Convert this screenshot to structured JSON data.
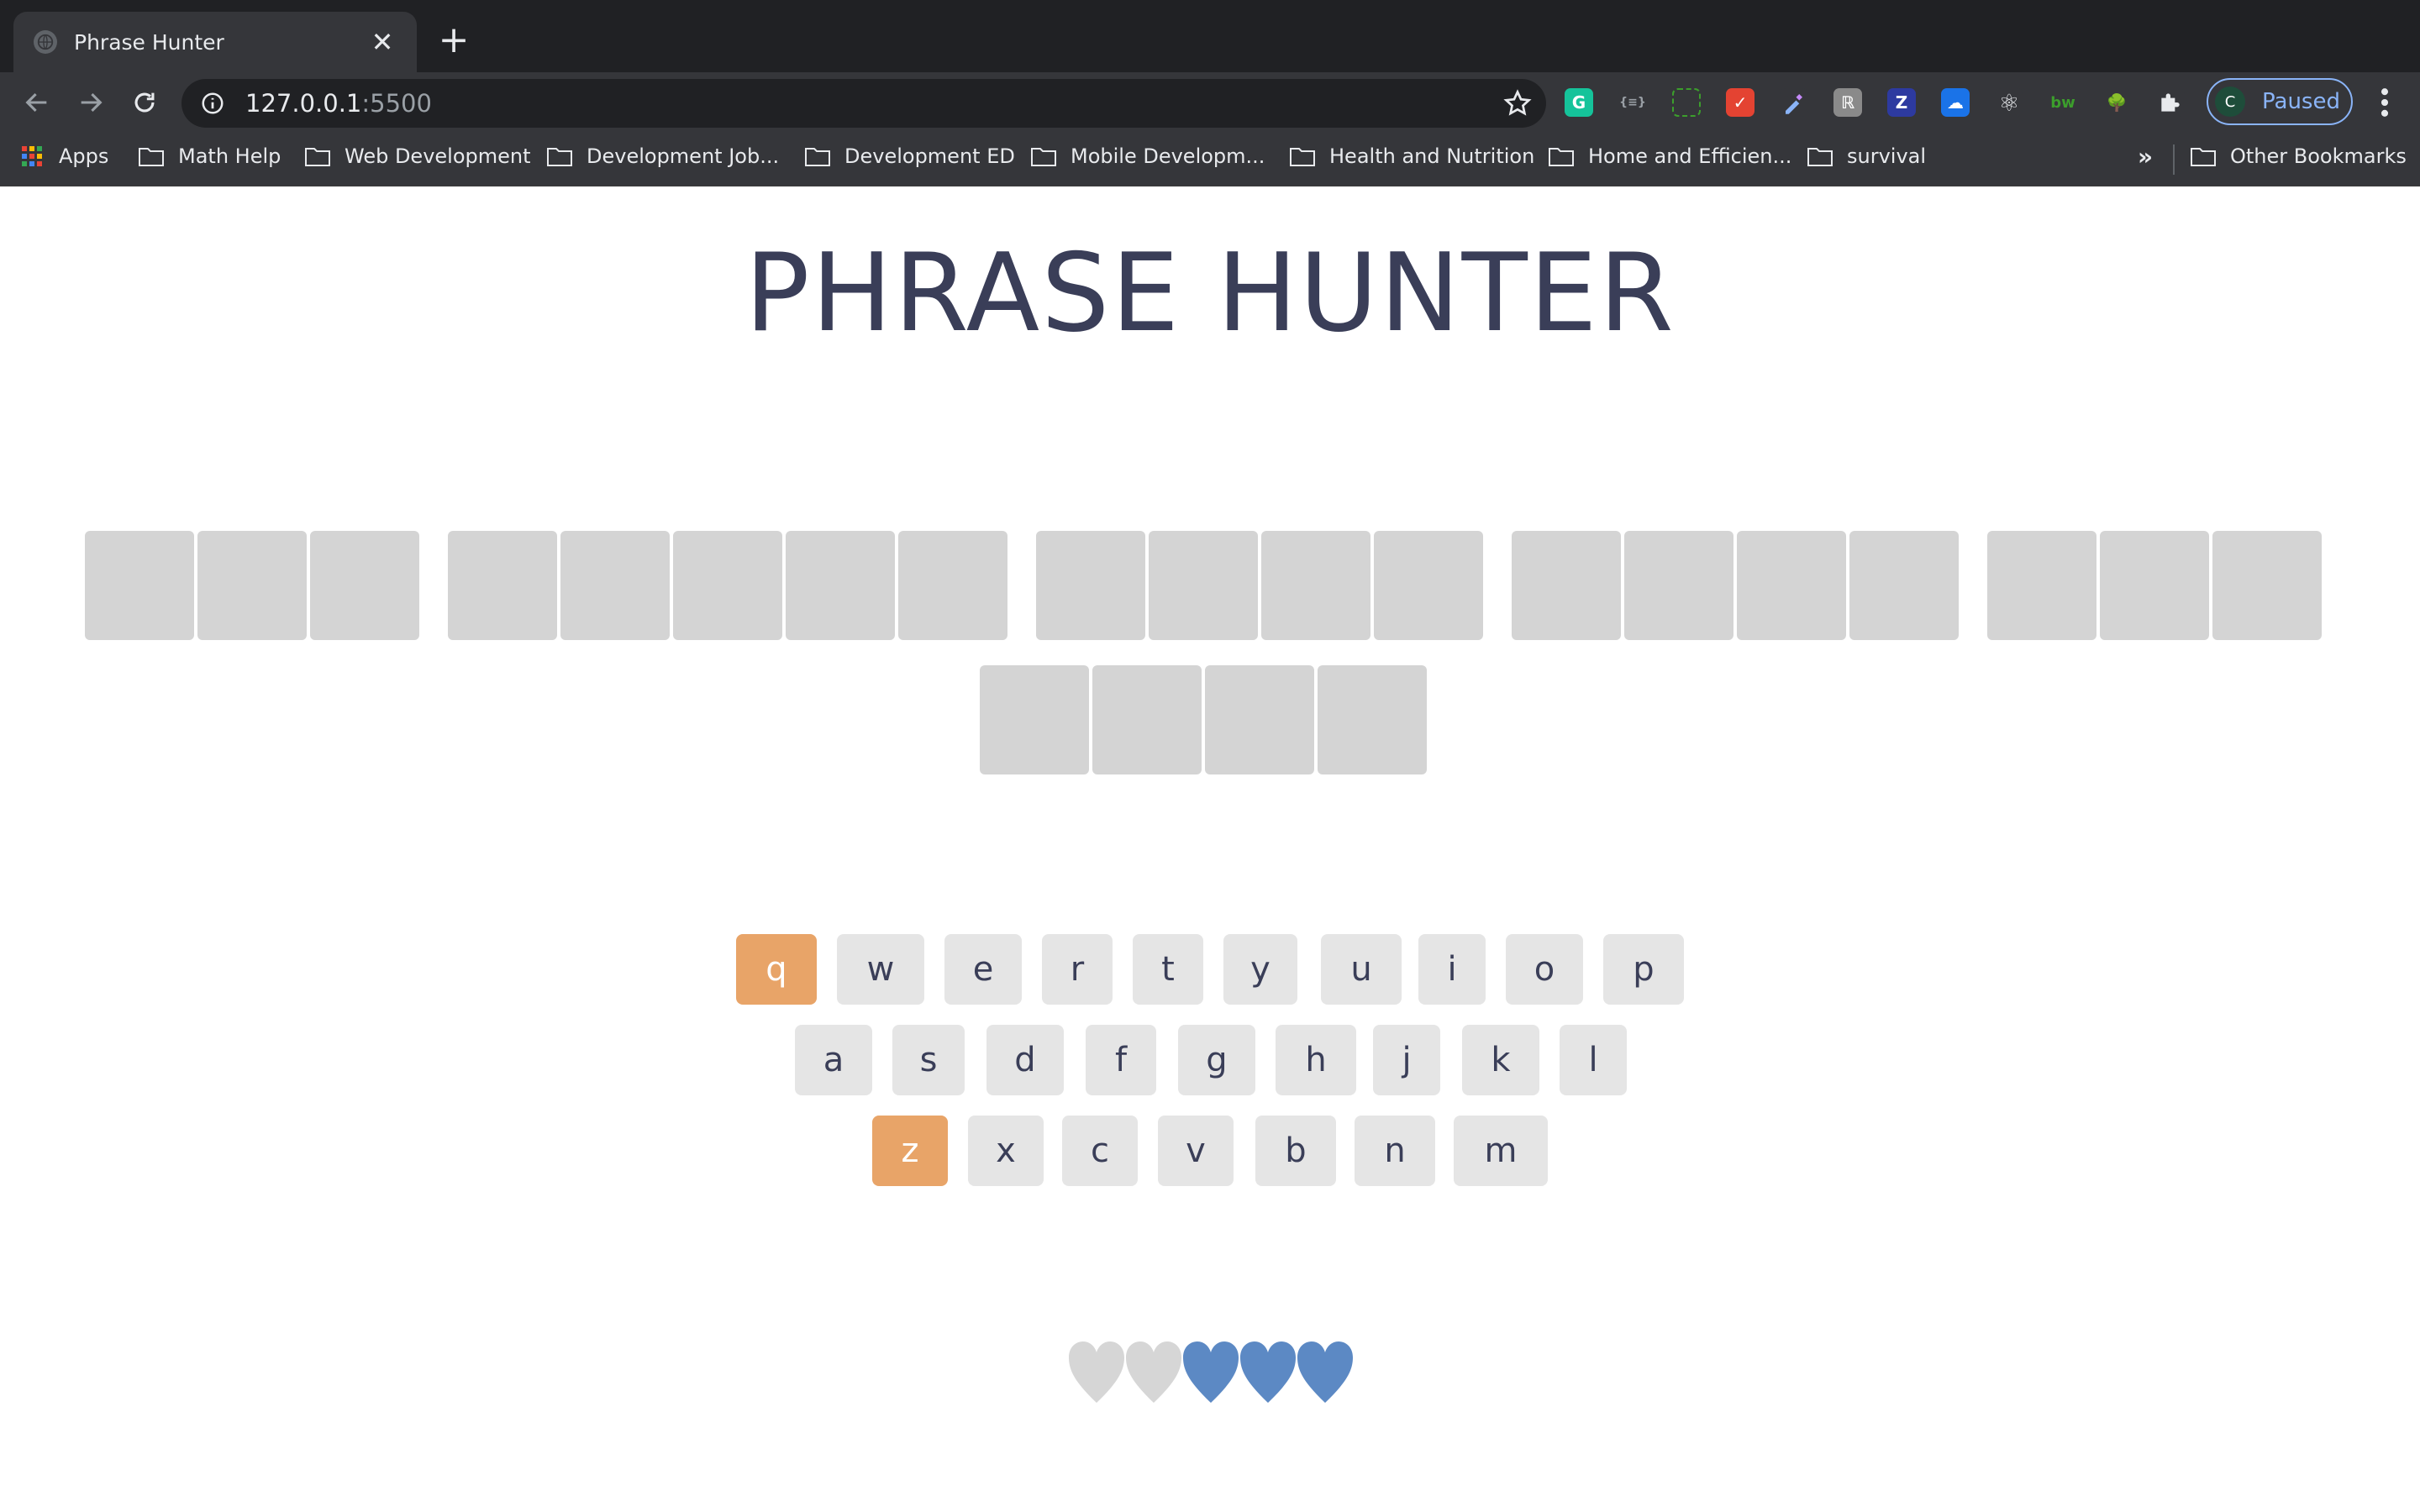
{
  "browser": {
    "tab_title": "Phrase Hunter",
    "tab_close": "✕",
    "new_tab": "+",
    "url_host": "127.0.0.1",
    "url_port": ":5500",
    "profile_initial": "C",
    "profile_status": "Paused",
    "extensions": [
      {
        "icon": "grammarly-icon",
        "label": "G",
        "color": "#15c39a"
      },
      {
        "icon": "json-icon",
        "label": "{≡}",
        "color": "#35363a"
      },
      {
        "icon": "screenshot-icon",
        "label": "",
        "color": "#35363a"
      },
      {
        "icon": "todoist-icon",
        "label": "✓",
        "color": "#e44332"
      },
      {
        "icon": "colorpicker-icon",
        "label": "",
        "color": "#35363a"
      },
      {
        "icon": "kanji-icon",
        "label": "ℝ",
        "color": "#8a8a8a"
      },
      {
        "icon": "zotero-icon",
        "label": "Z",
        "color": "#2d3aa0"
      },
      {
        "icon": "cloud-icon",
        "label": "☁",
        "color": "#1a73e8"
      },
      {
        "icon": "react-icon",
        "label": "⚛",
        "color": "#35363a"
      },
      {
        "icon": "bw-icon",
        "label": "bw",
        "color": "#35363a"
      },
      {
        "icon": "tree-icon",
        "label": "🌳",
        "color": "#35363a"
      },
      {
        "icon": "puzzle-icon",
        "label": "",
        "color": "#35363a"
      }
    ],
    "bookmarks": [
      {
        "label": "Apps",
        "icon": "apps-grid-icon"
      },
      {
        "label": "Math Help",
        "icon": "folder-icon"
      },
      {
        "label": "Web Development",
        "icon": "folder-icon"
      },
      {
        "label": "Development Job...",
        "icon": "folder-icon"
      },
      {
        "label": "Development ED",
        "icon": "folder-icon"
      },
      {
        "label": "Mobile Developm...",
        "icon": "folder-icon"
      },
      {
        "label": "Health and Nutrition",
        "icon": "folder-icon"
      },
      {
        "label": "Home and Efficien...",
        "icon": "folder-icon"
      },
      {
        "label": "survival",
        "icon": "folder-icon"
      }
    ],
    "bookmarks_overflow": "»",
    "other_bookmarks": "Other Bookmarks"
  },
  "game": {
    "title": "PHRASE HUNTER",
    "phrase_word_lengths": [
      3,
      5,
      4,
      4,
      3,
      4
    ],
    "keyboard_rows": [
      [
        "q",
        "w",
        "e",
        "r",
        "t",
        "y",
        "u",
        "i",
        "o",
        "p"
      ],
      [
        "a",
        "s",
        "d",
        "f",
        "g",
        "h",
        "j",
        "k",
        "l"
      ],
      [
        "z",
        "x",
        "c",
        "v",
        "b",
        "n",
        "m"
      ]
    ],
    "chosen_keys": [
      "q",
      "z"
    ],
    "lives_total": 5,
    "lives_lost": 2,
    "colors": {
      "title": "#3a3e58",
      "letter_box": "#d4d4d4",
      "key": "#e5e5e5",
      "key_chosen": "#e8a468",
      "heart_live": "#5c89c4",
      "heart_lost": "#d6d6d6"
    }
  }
}
